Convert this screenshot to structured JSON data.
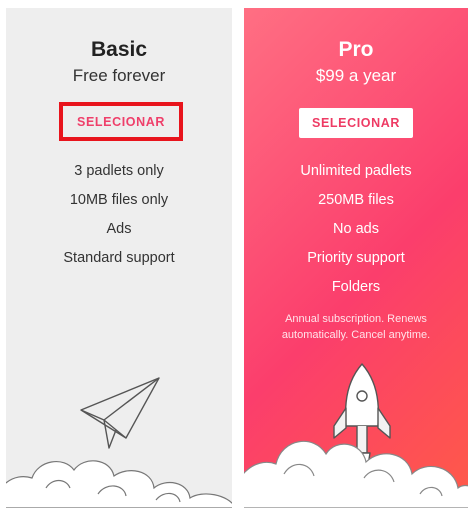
{
  "plans": {
    "basic": {
      "title": "Basic",
      "price": "Free forever",
      "button": "SELECIONAR",
      "features": [
        "3 padlets only",
        "10MB files only",
        "Ads",
        "Standard support"
      ]
    },
    "pro": {
      "title": "Pro",
      "price": "$99 a year",
      "button": "SELECIONAR",
      "features": [
        "Unlimited padlets",
        "250MB files",
        "No ads",
        "Priority support",
        "Folders"
      ],
      "note": "Annual subscription. Renews automatically. Cancel anytime."
    }
  },
  "highlight": {
    "color": "#e8141c",
    "target": "basic-select-button"
  },
  "icons": {
    "basic": "paper-plane-icon",
    "pro": "rocket-icon",
    "decor": "clouds-icon"
  },
  "colors": {
    "accent": "#ef3f6a",
    "basic_bg": "#eeeeee",
    "pro_gradient_start": "#ff6f83",
    "pro_gradient_end": "#ff5a48"
  }
}
